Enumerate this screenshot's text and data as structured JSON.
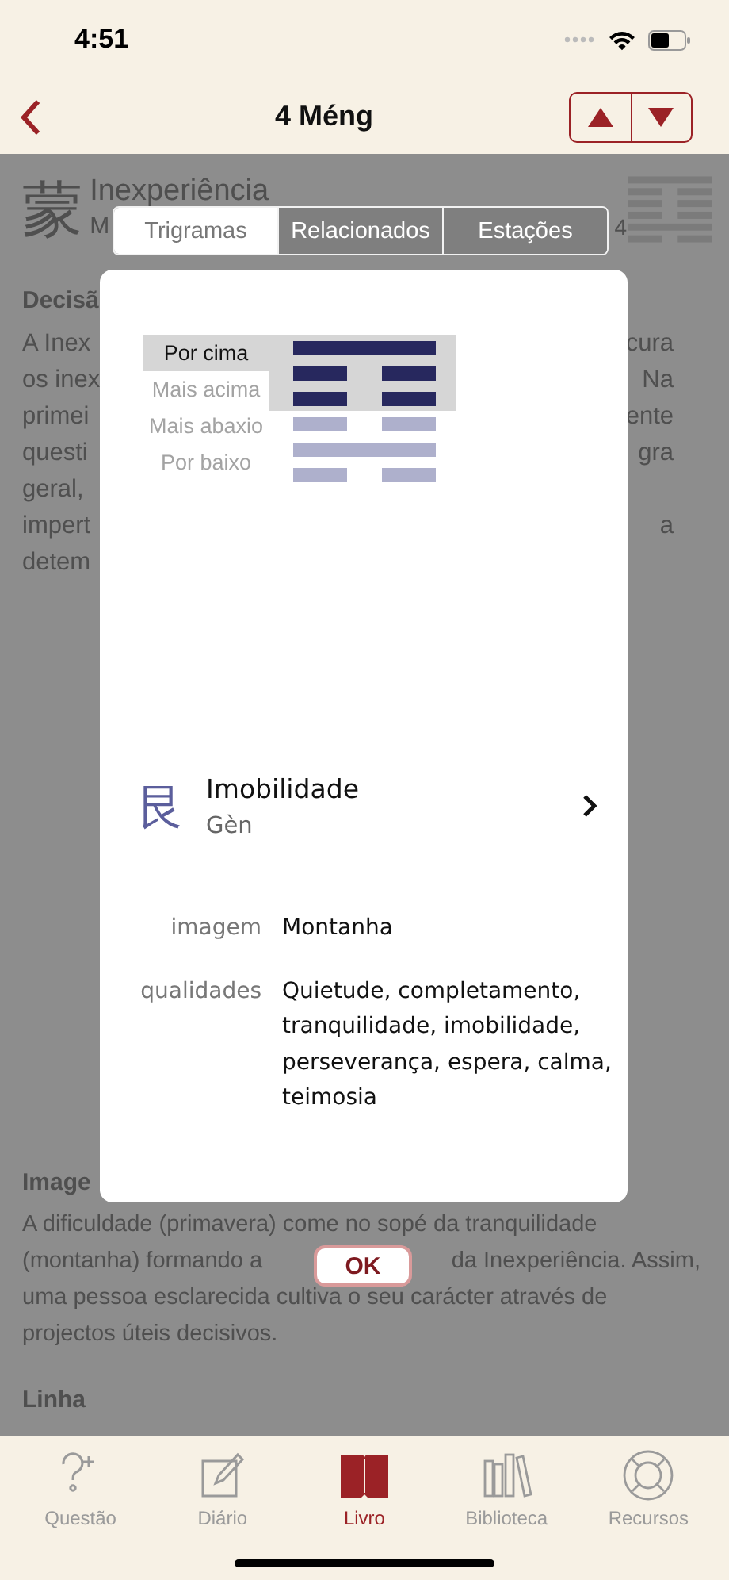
{
  "status_bar": {
    "time": "4:51"
  },
  "nav": {
    "title": "4 Méng"
  },
  "background": {
    "character": "蒙",
    "title": "Inexperiência",
    "subtitle": "M",
    "number": "4",
    "section_title": "Decisã",
    "lines": [
      {
        "left": "A Inex",
        "right": "cura"
      },
      {
        "left": "os inex",
        "right": "Na"
      },
      {
        "left": "primei",
        "right": "ente"
      },
      {
        "left": "questi",
        "right": "gra"
      },
      {
        "left": "geral,"
      },
      {
        "left": "impert",
        "right": "a"
      },
      {
        "left": "detem"
      }
    ],
    "section2_title": "Image",
    "paragraph": [
      {
        "left": "A dificuldade (primavera) come no sopé da tranquilidade"
      },
      {
        "left": "(montanha) formando a",
        "right": "da Inexperiência. Assim,"
      },
      {
        "left": "uma pessoa esclarecida cultiva o seu carácter através de"
      },
      {
        "left": "projectos úteis decisivos."
      }
    ],
    "section3_title": "Linha"
  },
  "segments": [
    {
      "label": "Trigramas",
      "selected": true
    },
    {
      "label": "Relacionados",
      "selected": false
    },
    {
      "label": "Estações",
      "selected": false
    }
  ],
  "dialog": {
    "positions": [
      {
        "label": "Por cima",
        "selected": true
      },
      {
        "label": "Mais acima",
        "selected": false
      },
      {
        "label": "Mais abaxio",
        "selected": false
      },
      {
        "label": "Por baixo",
        "selected": false
      }
    ],
    "hexagram_lines": [
      {
        "kind": "solid",
        "highlighted": true
      },
      {
        "kind": "broken",
        "highlighted": true
      },
      {
        "kind": "broken",
        "highlighted": true
      },
      {
        "kind": "broken",
        "highlighted": false
      },
      {
        "kind": "solid",
        "highlighted": false
      },
      {
        "kind": "broken",
        "highlighted": false
      }
    ],
    "trigram": {
      "character": "艮",
      "name": "Imobilidade",
      "romanization": "Gèn"
    },
    "properties": [
      {
        "label": "imagem",
        "value": "Montanha"
      },
      {
        "label": "qualidades",
        "value": "Quietude, completamento, tranquilidade, imobilidade, perseverança, espera, calma, teimosia"
      }
    ],
    "ok_button": "OK"
  },
  "tab_bar": [
    {
      "label": "Questão",
      "selected": false
    },
    {
      "label": "Diário",
      "selected": false
    },
    {
      "label": "Livro",
      "selected": true
    },
    {
      "label": "Biblioteca",
      "selected": false
    },
    {
      "label": "Recursos",
      "selected": false
    }
  ]
}
